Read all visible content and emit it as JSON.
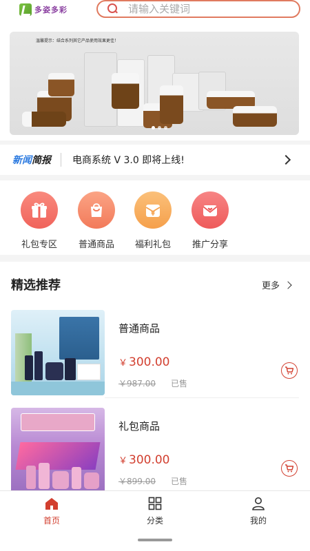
{
  "header": {
    "logo_text": "多姿多彩",
    "search_placeholder": "请输入关键词"
  },
  "banner": {
    "note": "温馨提示：结合系列其它产品使用效果更佳！",
    "slide_count": 3,
    "active_slide": 0
  },
  "news": {
    "tag_part1": "新闻",
    "tag_part2": "简报",
    "text": "电商系统 V 3.0 即将上线!"
  },
  "categories": [
    {
      "label": "礼包专区",
      "icon": "gift-icon",
      "color": "#f0635b"
    },
    {
      "label": "普通商品",
      "icon": "shopping-bag-icon",
      "color": "#f27a5a"
    },
    {
      "label": "福利礼包",
      "icon": "yen-gift-icon",
      "color": "#f5a04b"
    },
    {
      "label": "推广分享",
      "icon": "share-envelope-icon",
      "color": "#ee5a5a"
    }
  ],
  "recommend": {
    "title": "精选推荐",
    "more_label": "更多",
    "products": [
      {
        "name": "普通商品",
        "currency": "￥",
        "price": "300.00",
        "old_price": "￥987.00",
        "sold_label": "已售"
      },
      {
        "name": "礼包商品",
        "currency": "￥",
        "price": "300.00",
        "old_price": "￥899.00",
        "sold_label": "已售"
      }
    ]
  },
  "tabbar": {
    "items": [
      {
        "label": "首页",
        "icon": "home-icon",
        "active": true
      },
      {
        "label": "分类",
        "icon": "grid-icon",
        "active": false
      },
      {
        "label": "我的",
        "icon": "user-icon",
        "active": false
      }
    ]
  },
  "colors": {
    "accent": "#d23f2f",
    "news_blue": "#2d7be0"
  }
}
